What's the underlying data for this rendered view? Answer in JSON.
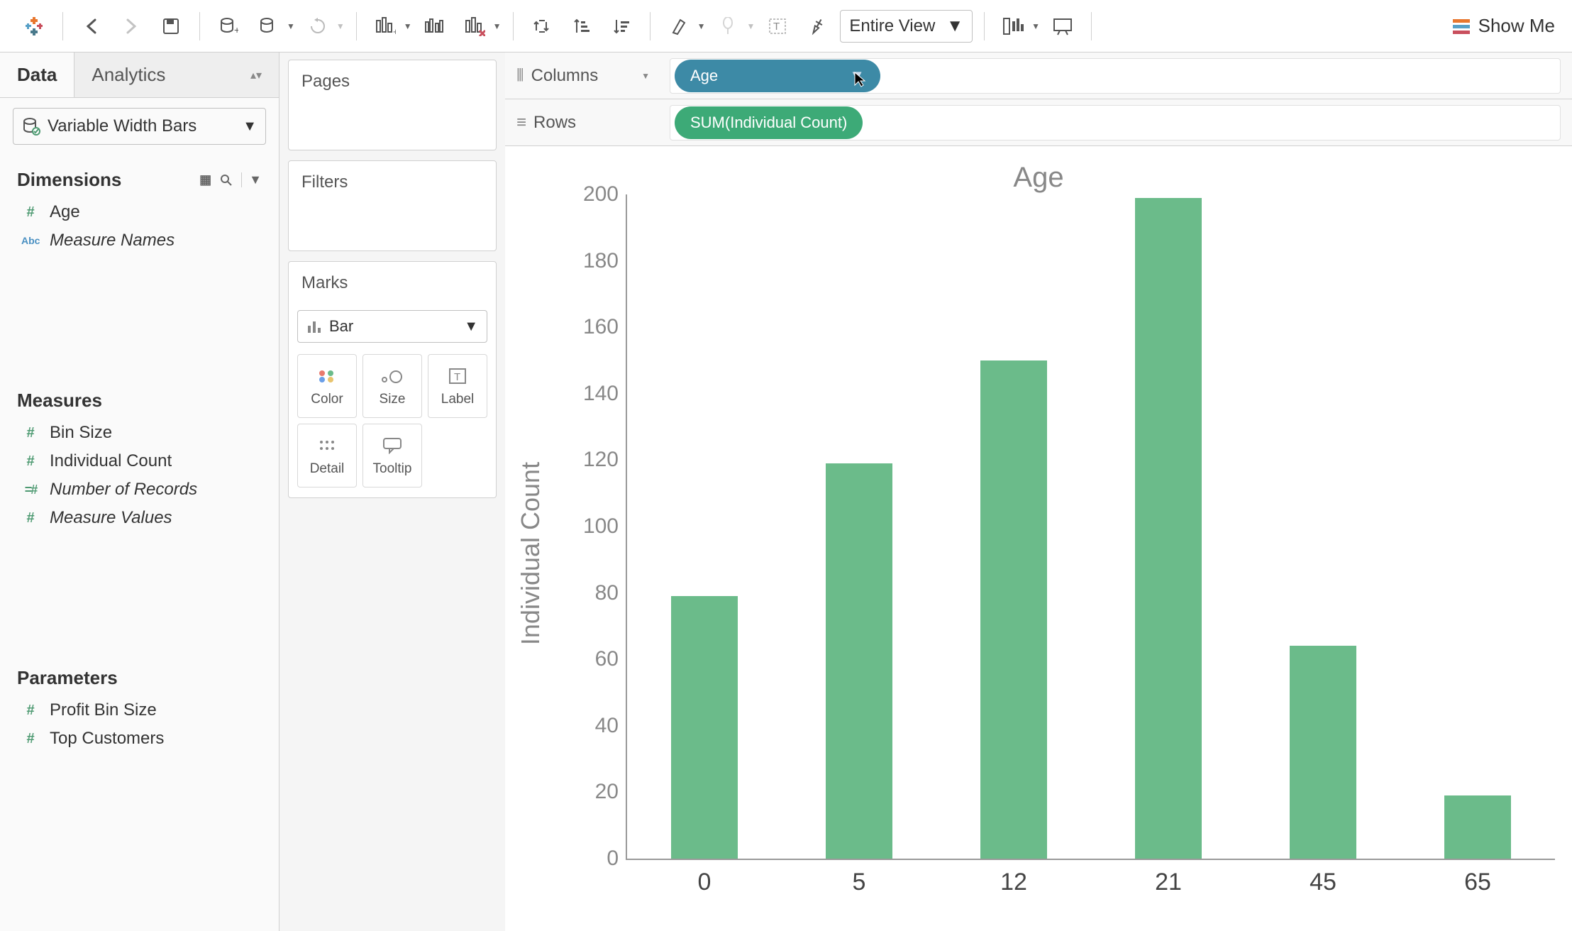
{
  "toolbar": {
    "view_mode": "Entire View",
    "show_me": "Show Me"
  },
  "tabs": {
    "data": "Data",
    "analytics": "Analytics"
  },
  "datasource": {
    "name": "Variable Width Bars"
  },
  "dimensions": {
    "title": "Dimensions",
    "items": [
      {
        "icon": "#",
        "label": "Age",
        "italic": false
      },
      {
        "icon": "Abc",
        "label": "Measure Names",
        "italic": true
      }
    ]
  },
  "measures": {
    "title": "Measures",
    "items": [
      {
        "icon": "#",
        "label": "Bin Size",
        "italic": false
      },
      {
        "icon": "#",
        "label": "Individual Count",
        "italic": false
      },
      {
        "icon": "=#",
        "label": "Number of Records",
        "italic": true
      },
      {
        "icon": "#",
        "label": "Measure Values",
        "italic": true
      }
    ]
  },
  "parameters": {
    "title": "Parameters",
    "items": [
      {
        "icon": "#",
        "label": "Profit Bin Size",
        "italic": false
      },
      {
        "icon": "#",
        "label": "Top Customers",
        "italic": false
      }
    ]
  },
  "cards": {
    "pages": "Pages",
    "filters": "Filters",
    "marks": "Marks",
    "mark_type": "Bar",
    "mark_buttons": {
      "color": "Color",
      "size": "Size",
      "label": "Label",
      "detail": "Detail",
      "tooltip": "Tooltip"
    }
  },
  "shelves": {
    "columns": "Columns",
    "rows": "Rows",
    "columns_pill": "Age",
    "rows_pill": "SUM(Individual Count)"
  },
  "chart_data": {
    "type": "bar",
    "title": "Age",
    "ylabel": "Individual Count",
    "xlabel": "",
    "categories": [
      "0",
      "5",
      "12",
      "21",
      "45",
      "65"
    ],
    "values": [
      79,
      119,
      150,
      199,
      64,
      19
    ],
    "ylim": [
      0,
      200
    ],
    "yticks": [
      0,
      20,
      40,
      60,
      80,
      100,
      120,
      140,
      160,
      180,
      200
    ],
    "bar_color": "#6bbb8a"
  }
}
